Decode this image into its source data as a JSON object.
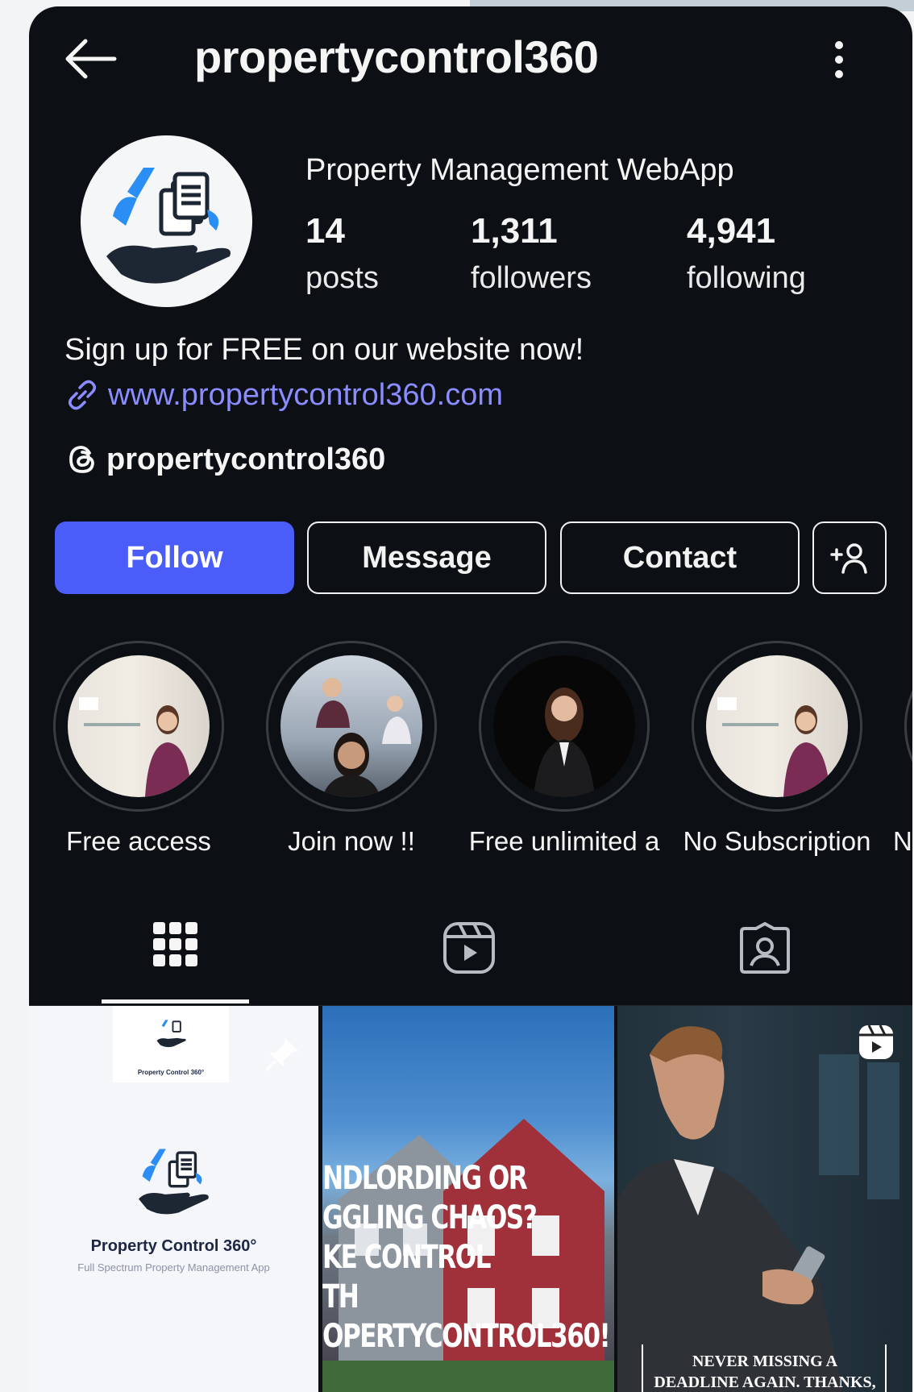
{
  "topbar": {
    "title": "propertycontrol360",
    "back_icon": "arrow-left-icon",
    "more_icon": "more-vertical-icon"
  },
  "profile": {
    "display_name": "Property Management WebApp",
    "stats": [
      {
        "value": "14",
        "label": "posts"
      },
      {
        "value": "1,311",
        "label": "followers"
      },
      {
        "value": "4,941",
        "label": "following"
      }
    ],
    "bio": "Sign up for FREE on our website now!",
    "link": "www.propertycontrol360.com",
    "threads_handle": "propertycontrol360"
  },
  "actions": {
    "follow": "Follow",
    "message": "Message",
    "contact": "Contact"
  },
  "highlights": [
    {
      "label": "Free access"
    },
    {
      "label": "Join now !!"
    },
    {
      "label": "Free unlimited a"
    },
    {
      "label": "No Subscription"
    },
    {
      "label": "N"
    }
  ],
  "grid": {
    "tile1": {
      "name": "Property Control 360°",
      "subtitle": "Full Spectrum Property Management App"
    },
    "tile2": {
      "lines": [
        "NDLORDING OR",
        "GGLING CHAOS?",
        "KE CONTROL",
        "TH",
        "OPERTYCONTROL360!"
      ],
      "logo_text": "Property Control 360°"
    },
    "tile3": {
      "caption_lines": [
        "NEVER MISSING A",
        "DEADLINE AGAIN. THANKS,"
      ]
    }
  },
  "colors": {
    "background": "#0c1014",
    "accent": "#4a5df9",
    "link": "#8a8cff"
  }
}
